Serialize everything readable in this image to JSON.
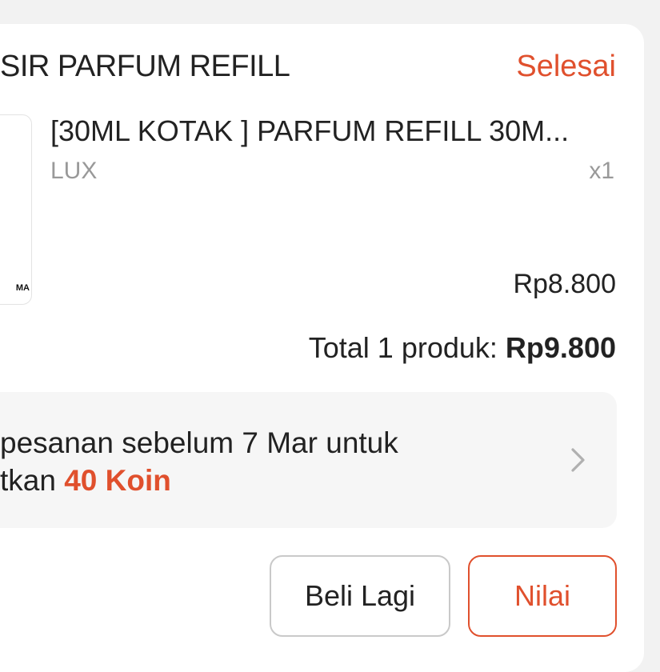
{
  "order": {
    "shop_name": "SIR PARFUM REFILL",
    "status": "Selesai",
    "thumbnail_text": "MA",
    "product_name": "[30ML KOTAK  ] PARFUM REFILL 30M...",
    "variation": "LUX",
    "quantity": "x1",
    "price": "Rp8.800",
    "total_label": "Total 1 produk: ",
    "total_value": "Rp9.800"
  },
  "promo": {
    "line1": "pesanan sebelum 7 Mar untuk",
    "line2_prefix": "tkan ",
    "coins": "40 Koin",
    "chevron_icon": "chevron-right-icon"
  },
  "actions": {
    "buy_again_label": "Beli Lagi",
    "rate_label": "Nilai"
  },
  "colors": {
    "accent": "#e0502d",
    "background": "#f2f2f2",
    "card": "#ffffff"
  }
}
